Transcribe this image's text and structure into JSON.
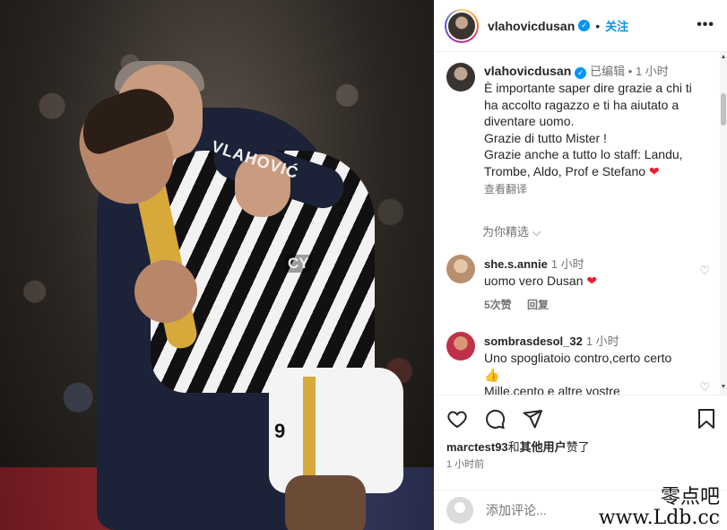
{
  "post": {
    "photo_text": {
      "jersey_name": "VLAHOVIĆ",
      "sponsor": "CY",
      "shorts_number": "9"
    }
  },
  "header": {
    "username": "vlahovicdusan",
    "separator": "•",
    "follow_label": "关注",
    "more_label": "•••"
  },
  "caption": {
    "username": "vlahovicdusan",
    "edited": "已编辑",
    "separator": " • ",
    "time": "1 小时",
    "text": "È importante saper dire grazie a chi ti ha accolto ragazzo e ti ha aiutato a diventare uomo.\nGrazie di tutto Mister !\nGrazie anche a tutto lo staff: Landu, Trombe, Aldo, Prof e Stefano",
    "heart": "❤",
    "translate_label": "查看翻译"
  },
  "filter_label": "为你精选 ⌵",
  "comments": [
    {
      "username": "she.s.annie",
      "time": "1 小时",
      "text": "uomo vero Dusan",
      "emoji": "❤",
      "likes": "5次赞",
      "reply_label": "回复"
    },
    {
      "username": "sombrasdesol_32",
      "time": "1 小时",
      "text": "Uno spogliatoio contro,certo certo",
      "emoji": "👍",
      "more_text": "Mille.cento e altre vostre"
    }
  ],
  "actions": {
    "like_icon": "heart-outline",
    "comment_icon": "speech-bubble",
    "share_icon": "paper-plane",
    "save_icon": "bookmark",
    "liked_by_user": "marctest93",
    "liked_by_suffix": "和",
    "liked_by_others": "其他用户",
    "liked_by_end": "赞了",
    "posted_time": "1 小时前"
  },
  "add_comment": {
    "placeholder": "添加评论..."
  },
  "watermark": {
    "cn": "零点吧",
    "url": "www.Ldb.cc"
  },
  "colors": {
    "link_blue": "#0095f6",
    "heart_red": "#ed1c2e",
    "muted_text": "#737373"
  }
}
